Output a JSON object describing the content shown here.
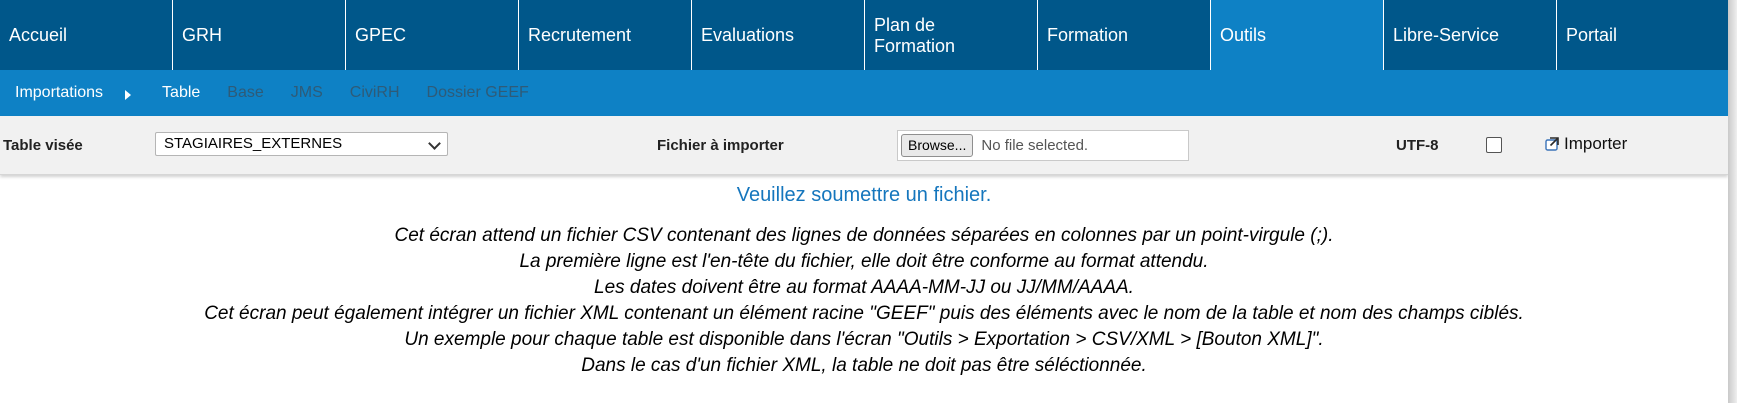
{
  "main_nav": [
    {
      "label": "Accueil",
      "active": false
    },
    {
      "label": "GRH",
      "active": false
    },
    {
      "label": "GPEC",
      "active": false
    },
    {
      "label": "Recrutement",
      "active": false
    },
    {
      "label": "Evaluations",
      "active": false
    },
    {
      "label": "Plan de Formation",
      "active": false
    },
    {
      "label": "Formation",
      "active": false
    },
    {
      "label": "Outils",
      "active": true
    },
    {
      "label": "Libre-Service",
      "active": false
    },
    {
      "label": "Portail",
      "active": false
    }
  ],
  "sub_nav": {
    "first": "Importations",
    "items": [
      {
        "label": "Table",
        "current": true
      },
      {
        "label": "Base",
        "current": false
      },
      {
        "label": "JMS",
        "current": false
      },
      {
        "label": "CiviRH",
        "current": false
      },
      {
        "label": "Dossier GEEF",
        "current": false
      }
    ]
  },
  "toolbar": {
    "table_label": "Table visée",
    "table_value": "STAGIAIRES_EXTERNES",
    "file_label": "Fichier à importer",
    "browse_label": "Browse...",
    "file_status": "No file selected.",
    "utf_label": "UTF-8",
    "utf_checked": false,
    "import_label": "Importer"
  },
  "content": {
    "message": "Veuillez soumettre un fichier.",
    "instructions": [
      "Cet écran attend un fichier CSV contenant des lignes de données séparées en colonnes par un point-virgule (;).",
      "La première ligne est l'en-tête du fichier, elle doit être conforme au format attendu.",
      "Les dates doivent être au format AAAA-MM-JJ ou JJ/MM/AAAA.",
      "Cet écran peut également intégrer un fichier XML contenant un élément racine \"GEEF\" puis des éléments avec le nom de la table et nom des champs ciblés.",
      "Un exemple pour chaque table est disponible dans l'écran \"Outils > Exportation > CSV/XML > [Bouton XML]\".",
      "Dans le cas d'un fichier XML, la table ne doit pas être séléctionnée."
    ]
  },
  "colors": {
    "nav_bg": "#00578a",
    "nav_active": "#0e81c5",
    "subnav_bg": "#0e81c5",
    "subnav_dim_text": "#2e5b78",
    "message_text": "#1576bd",
    "toolbar_bg": "#f1f1f1"
  },
  "icons": {
    "subnav_arrow": "arrow-right-icon",
    "select_caret": "chevron-down-icon",
    "import": "import-icon"
  }
}
